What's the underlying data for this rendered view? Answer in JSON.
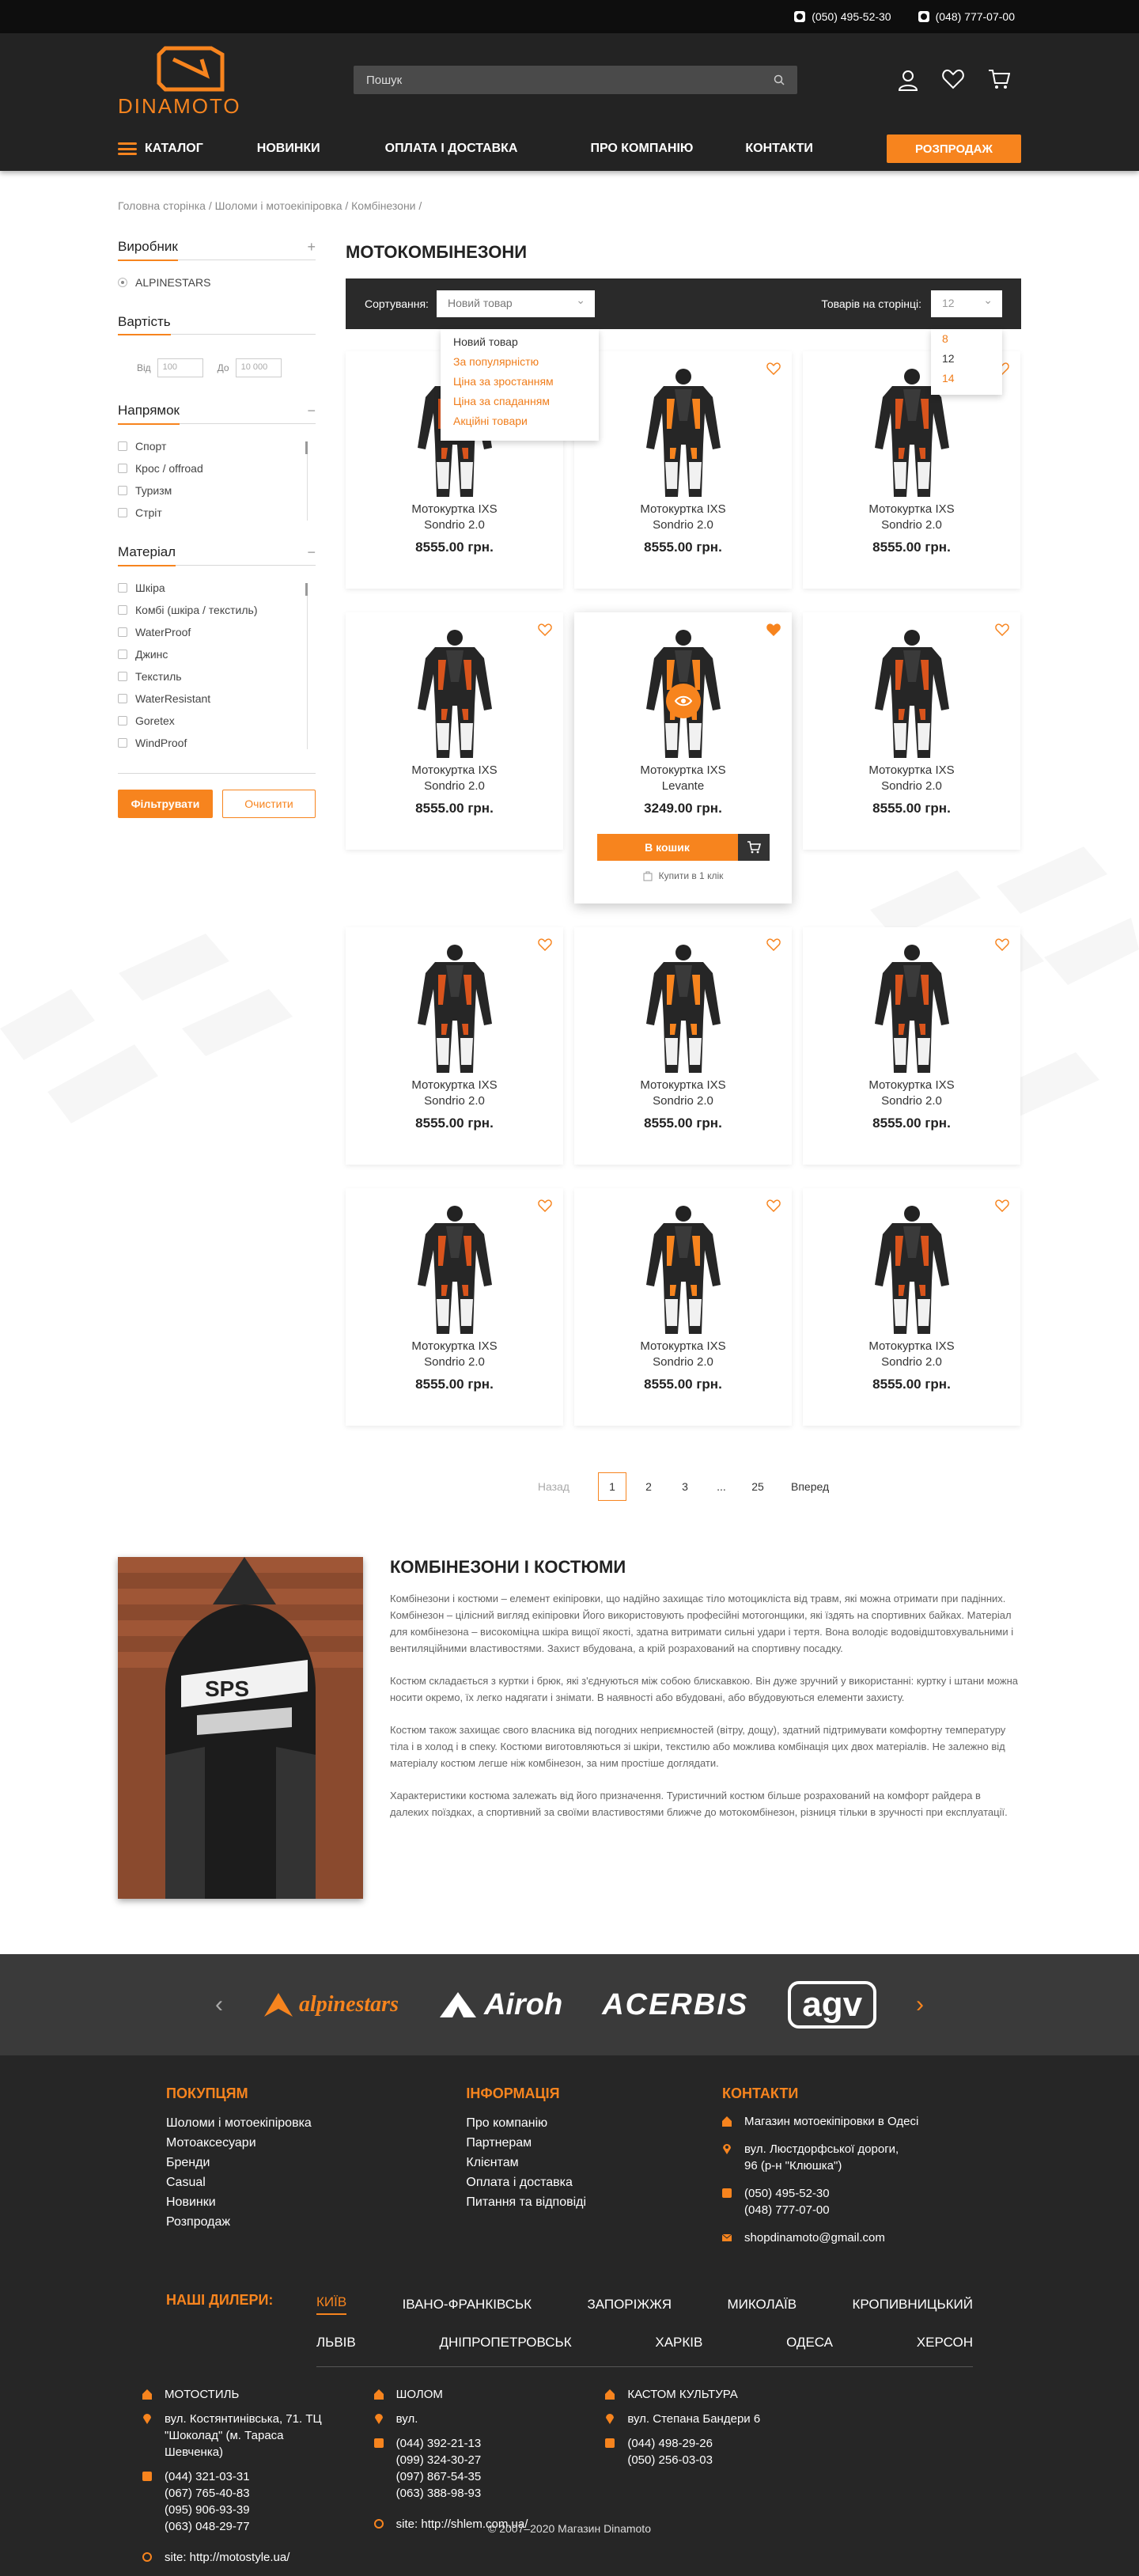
{
  "topbar": {
    "phone1": "(050) 495-52-30",
    "phone2": "(048) 777-07-00"
  },
  "header": {
    "logo_text": "DINAMOTO",
    "search_placeholder": "Пошук"
  },
  "nav": {
    "catalog": "КАТАЛОГ",
    "items": [
      "НОВИНКИ",
      "ОПЛАТА І ДОСТАВКА",
      "ПРО КОМПАНІЮ",
      "КОНТАКТИ"
    ],
    "sale": "РОЗПРОДАЖ"
  },
  "breadcrumbs": [
    "Головна сторінка /",
    "Шоломи і мотоекіпіровка /",
    "Комбінезони /"
  ],
  "filters": {
    "maker_title": "Виробник",
    "maker_options": [
      "ALPINESTARS"
    ],
    "price_title": "Вартість",
    "price_from": "Від",
    "price_from_val": "100",
    "price_to": "До",
    "price_to_val": "10 000",
    "dir_title": "Напрямок",
    "dir_options": [
      "Спорт",
      "Крос / offroad",
      "Туризм",
      "Стріт"
    ],
    "mat_title": "Матеріал",
    "mat_options": [
      "Шкіра",
      "Комбі (шкіра / текстиль)",
      "WaterProof",
      "Джинс",
      "Текстиль",
      "WaterResistant",
      "Goretex",
      "WindProof"
    ],
    "apply": "Фільтрувати",
    "clear": "Очистити"
  },
  "page": {
    "title": "МОТОКОМБІНЕЗОНИ"
  },
  "sort": {
    "label": "Сортування:",
    "value": "Новий товар",
    "options": [
      "Новий товар",
      "За популярністю",
      "Ціна за зростанням",
      "Ціна за спаданням",
      "Акційні товари"
    ],
    "per_page_label": "Товарів на сторінці:",
    "per_page_value": "12",
    "per_page_options": [
      "8",
      "12",
      "14"
    ]
  },
  "products": [
    {
      "l1": "Мотокуртка IXS",
      "l2": "Sondrio 2.0",
      "price": "8555.00 грн."
    },
    {
      "l1": "Мотокуртка IXS",
      "l2": "Sondrio 2.0",
      "price": "8555.00 грн."
    },
    {
      "l1": "Мотокуртка IXS",
      "l2": "Sondrio 2.0",
      "price": "8555.00 грн."
    },
    {
      "l1": "Мотокуртка IXS",
      "l2": "Sondrio 2.0",
      "price": "8555.00 грн."
    },
    {
      "l1": "Мотокуртка IXS",
      "l2": "Levante",
      "price": "3249.00 грн.",
      "buy": "В кошик",
      "oneclick": "Купити в 1 клік"
    },
    {
      "l1": "Мотокуртка IXS",
      "l2": "Sondrio 2.0",
      "price": "8555.00 грн."
    },
    {
      "l1": "Мотокуртка IXS",
      "l2": "Sondrio 2.0",
      "price": "8555.00 грн."
    },
    {
      "l1": "Мотокуртка IXS",
      "l2": "Sondrio 2.0",
      "price": "8555.00 грн."
    },
    {
      "l1": "Мотокуртка IXS",
      "l2": "Sondrio 2.0",
      "price": "8555.00 грн."
    },
    {
      "l1": "Мотокуртка IXS",
      "l2": "Sondrio 2.0",
      "price": "8555.00 грн."
    },
    {
      "l1": "Мотокуртка IXS",
      "l2": "Sondrio 2.0",
      "price": "8555.00 грн."
    },
    {
      "l1": "Мотокуртка IXS",
      "l2": "Sondrio 2.0",
      "price": "8555.00 грн."
    }
  ],
  "pagination": {
    "prev": "Назад",
    "pages": [
      "1",
      "2",
      "3",
      "...",
      "25"
    ],
    "next": "Вперед"
  },
  "seo": {
    "title": "КОМБІНЕЗОНИ І КОСТЮМИ",
    "p1": "Комбінезони і костюми – елемент екіпіровки, що надійно захищає тіло мотоцикліста від травм, які можна отримати при падінних. Комбінезон – цілісний вигляд екіпіровки Його використовують професійні мотогонщики, які їздять на спортивних байках. Матеріал для комбінезона – високоміцна шкіра вищої якості, здатна витримати сильні удари і тертя. Вона володіє водовідштовхувальними і вентиляційними властивостями. Захист вбудована, а крій розрахований на спортивну посадку.",
    "p2": "Костюм складається з куртки і брюк, які з'єднуються між собою блискавкою. Він дуже зручний у використанні: куртку і штани можна носити окремо, їх легко надягати і знімати. В наявності або вбудовані, або вбудовуються елементи захисту.",
    "p3": "Костюм також захищає свого власника від погодних неприємностей (вітру, дощу), здатний підтримувати комфортну температуру тіла і в холод і в спеку. Костюми виготовляються зі шкіри, текстилю або можлива комбінація цих двох матеріалів. Не залежно від матеріалу костюм легше ніж комбінезон, за ним простіше доглядати.",
    "p4": "Характеристики костюма залежать від його призначення. Туристичний костюм більше розрахований на комфорт райдера в далеких поїздках, а спортивний за своїми властивостями ближче до мотокомбінезон, різниця тільки в зручності при експлуатації."
  },
  "brands": [
    "alpinestars",
    "Airoh",
    "ACERBIS",
    "agv"
  ],
  "footer": {
    "buyers_title": "ПОКУПЦЯМ",
    "buyers": [
      "Шоломи і мотоекіпіровка",
      "Мотоаксесуари",
      "Бренди",
      "Casual",
      "Новинки",
      "Розпродаж"
    ],
    "info_title": "ІНФОРМАЦІЯ",
    "info": [
      "Про компанію",
      "Партнерам",
      "Клієнтам",
      "Оплата і доставка",
      "Питання та відповіді"
    ],
    "contacts_title": "КОНТАКТИ",
    "shop": "Магазин мотоекіпіровки в Одесі",
    "addr1": "вул. Люстдорфської дороги,",
    "addr2": "96 (р-н \"Клюшка\")",
    "phone1": "(050) 495-52-30",
    "phone2": "(048) 777-07-00",
    "email": "shopdinamoto@gmail.com",
    "dealers_label": "НАШІ ДИЛЕРИ:",
    "cities_row1": [
      "КИЇВ",
      "ІВАНО-ФРАНКІВСЬК",
      "ЗАПОРІЖЖЯ",
      "МИКОЛАЇВ",
      "КРОПИВНИЦЬКИЙ"
    ],
    "cities_row2": [
      "ЛЬВІВ",
      "ДНІПРОПЕТРОВСЬК",
      "ХАРКІВ",
      "ОДЕСА",
      "ХЕРСОН"
    ],
    "shops": [
      {
        "name": "МОТОСТИЛЬ",
        "addr": "вул. Костянтинівська, 71. ТЦ \"Шоколад\" (м. Тараса Шевченка)",
        "phones": [
          "(044) 321-03-31",
          "(067) 765-40-83",
          "(095) 906-93-39",
          "(063) 048-29-77"
        ],
        "site": "site: http://motostyle.ua/"
      },
      {
        "name": "ШОЛОМ",
        "addr": "вул.",
        "phones": [
          "(044) 392-21-13",
          "(099) 324-30-27",
          "(097) 867-54-35",
          "(063) 388-98-93"
        ],
        "site": "site: http://shlem.com.ua/"
      },
      {
        "name": "КАСТОМ КУЛЬТУРА",
        "addr": "вул. Степана Бандери 6",
        "phones": [
          "(044) 498-29-26",
          "(050) 256-03-03"
        ],
        "site": ""
      }
    ],
    "copyright": "© 2007–2020 Магазин Dinamoto"
  },
  "colors": {
    "accent": "#f7841e",
    "dark": "#232323"
  }
}
